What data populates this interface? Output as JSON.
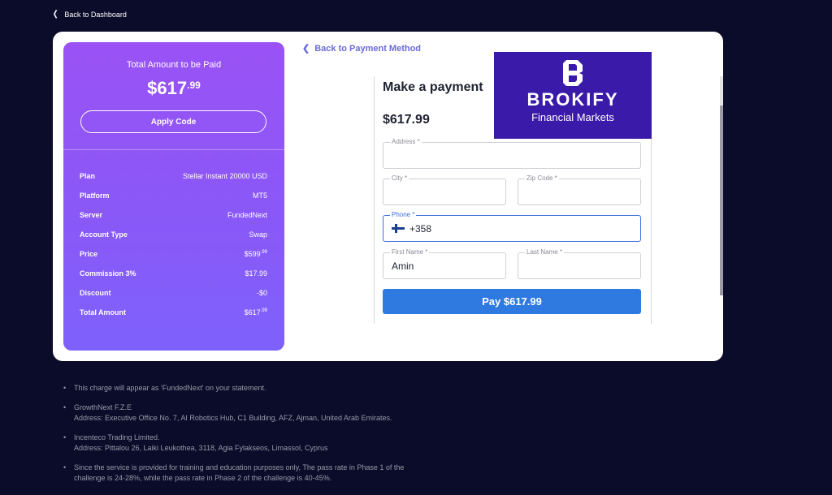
{
  "nav": {
    "back_dashboard": "Back to Dashboard",
    "back_payment": "Back to Payment Method"
  },
  "summary": {
    "title": "Total Amount to be Paid",
    "amount_main": "$617",
    "amount_cents": ".99",
    "apply_code": "Apply Code",
    "rows": [
      {
        "label": "Plan",
        "value": "Stellar Instant 20000 USD",
        "cents": ""
      },
      {
        "label": "Platform",
        "value": "MT5",
        "cents": ""
      },
      {
        "label": "Server",
        "value": "FundedNext",
        "cents": ""
      },
      {
        "label": "Account Type",
        "value": "Swap",
        "cents": ""
      },
      {
        "label": "Price",
        "value": "$599",
        "cents": ".99"
      },
      {
        "label": "Commission 3%",
        "value": "$17.99",
        "cents": ""
      },
      {
        "label": "Discount",
        "value": "-$0",
        "cents": ""
      },
      {
        "label": "Total Amount",
        "value": "$617",
        "cents": ".99"
      }
    ]
  },
  "payment": {
    "heading": "Make a payment",
    "amount": "$617.99",
    "fields": {
      "address": {
        "label": "Address *",
        "value": ""
      },
      "city": {
        "label": "City *",
        "value": ""
      },
      "zip": {
        "label": "Zip Code *",
        "value": ""
      },
      "phone": {
        "label": "Phone *",
        "value": "+358"
      },
      "first_name": {
        "label": "First Name *",
        "value": "Amin"
      },
      "last_name": {
        "label": "Last Name *",
        "value": ""
      }
    },
    "pay_button": "Pay $617.99"
  },
  "brand": {
    "name": "BROKIFY",
    "tagline": "Financial Markets",
    "logo_icon": "brokify-logo-icon"
  },
  "notes": [
    {
      "line1": "This charge will appear as 'FundedNext' on your statement.",
      "line2": ""
    },
    {
      "line1": "GrowthNext F.Z.E",
      "line2": "Address: Executive Office No. 7, AI Robotics Hub, C1 Building, AFZ, Ajman, United Arab Emirates."
    },
    {
      "line1": "Incenteco Trading Limited.",
      "line2": "Address: Pittalou 26, Laiki Leukothea, 3118, Agia Fylakseos, Limassol, Cyprus"
    },
    {
      "line1": "Since the service is provided for training and education purposes only, The pass rate in Phase 1 of the",
      "line2": "challenge is 24-28%, while the pass rate in Phase 2 of the challenge is 40-45%."
    }
  ],
  "colors": {
    "background": "#0b0b2a",
    "summary_gradient_top": "#9a52f5",
    "summary_gradient_bottom": "#7e61fb",
    "pay_button": "#2f7ae0",
    "brand_bg": "#3a1aa8",
    "link": "#6b6bd8"
  }
}
